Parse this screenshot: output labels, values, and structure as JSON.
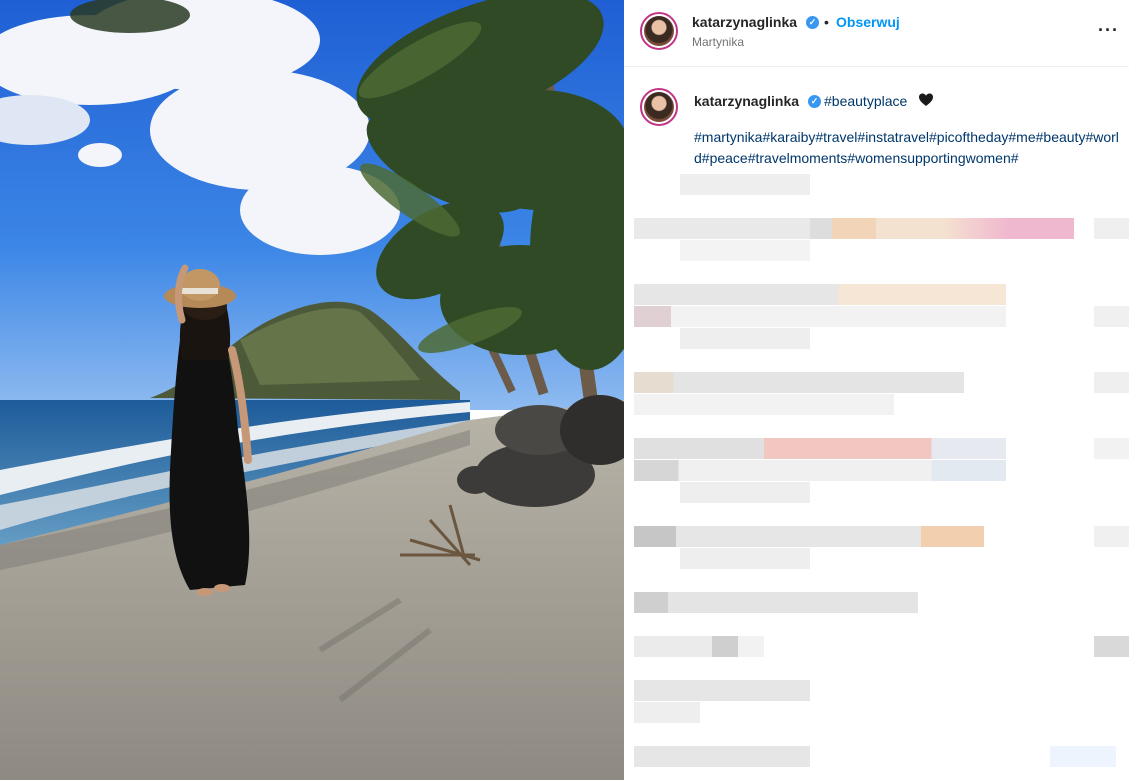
{
  "post": {
    "username": "katarzynaglinka",
    "separator": "•",
    "follow_label": "Obserwuj",
    "location": "Martynika",
    "more_label": "···"
  },
  "caption": {
    "username": "katarzynaglinka",
    "tag": "#beautyplace",
    "emoji_icon": "black-heart-icon",
    "hashtags": "#martynika#karaiby#travel#instatravel#picoftheday#me#beauty#world#peace#travelmoments#womensupportingwomen#"
  },
  "colors": {
    "link": "#0095f6",
    "hashtag": "#00376b",
    "verified": "#3897f0"
  },
  "icons": [
    "verified-badge-icon",
    "more-options-icon",
    "black-heart-icon"
  ]
}
